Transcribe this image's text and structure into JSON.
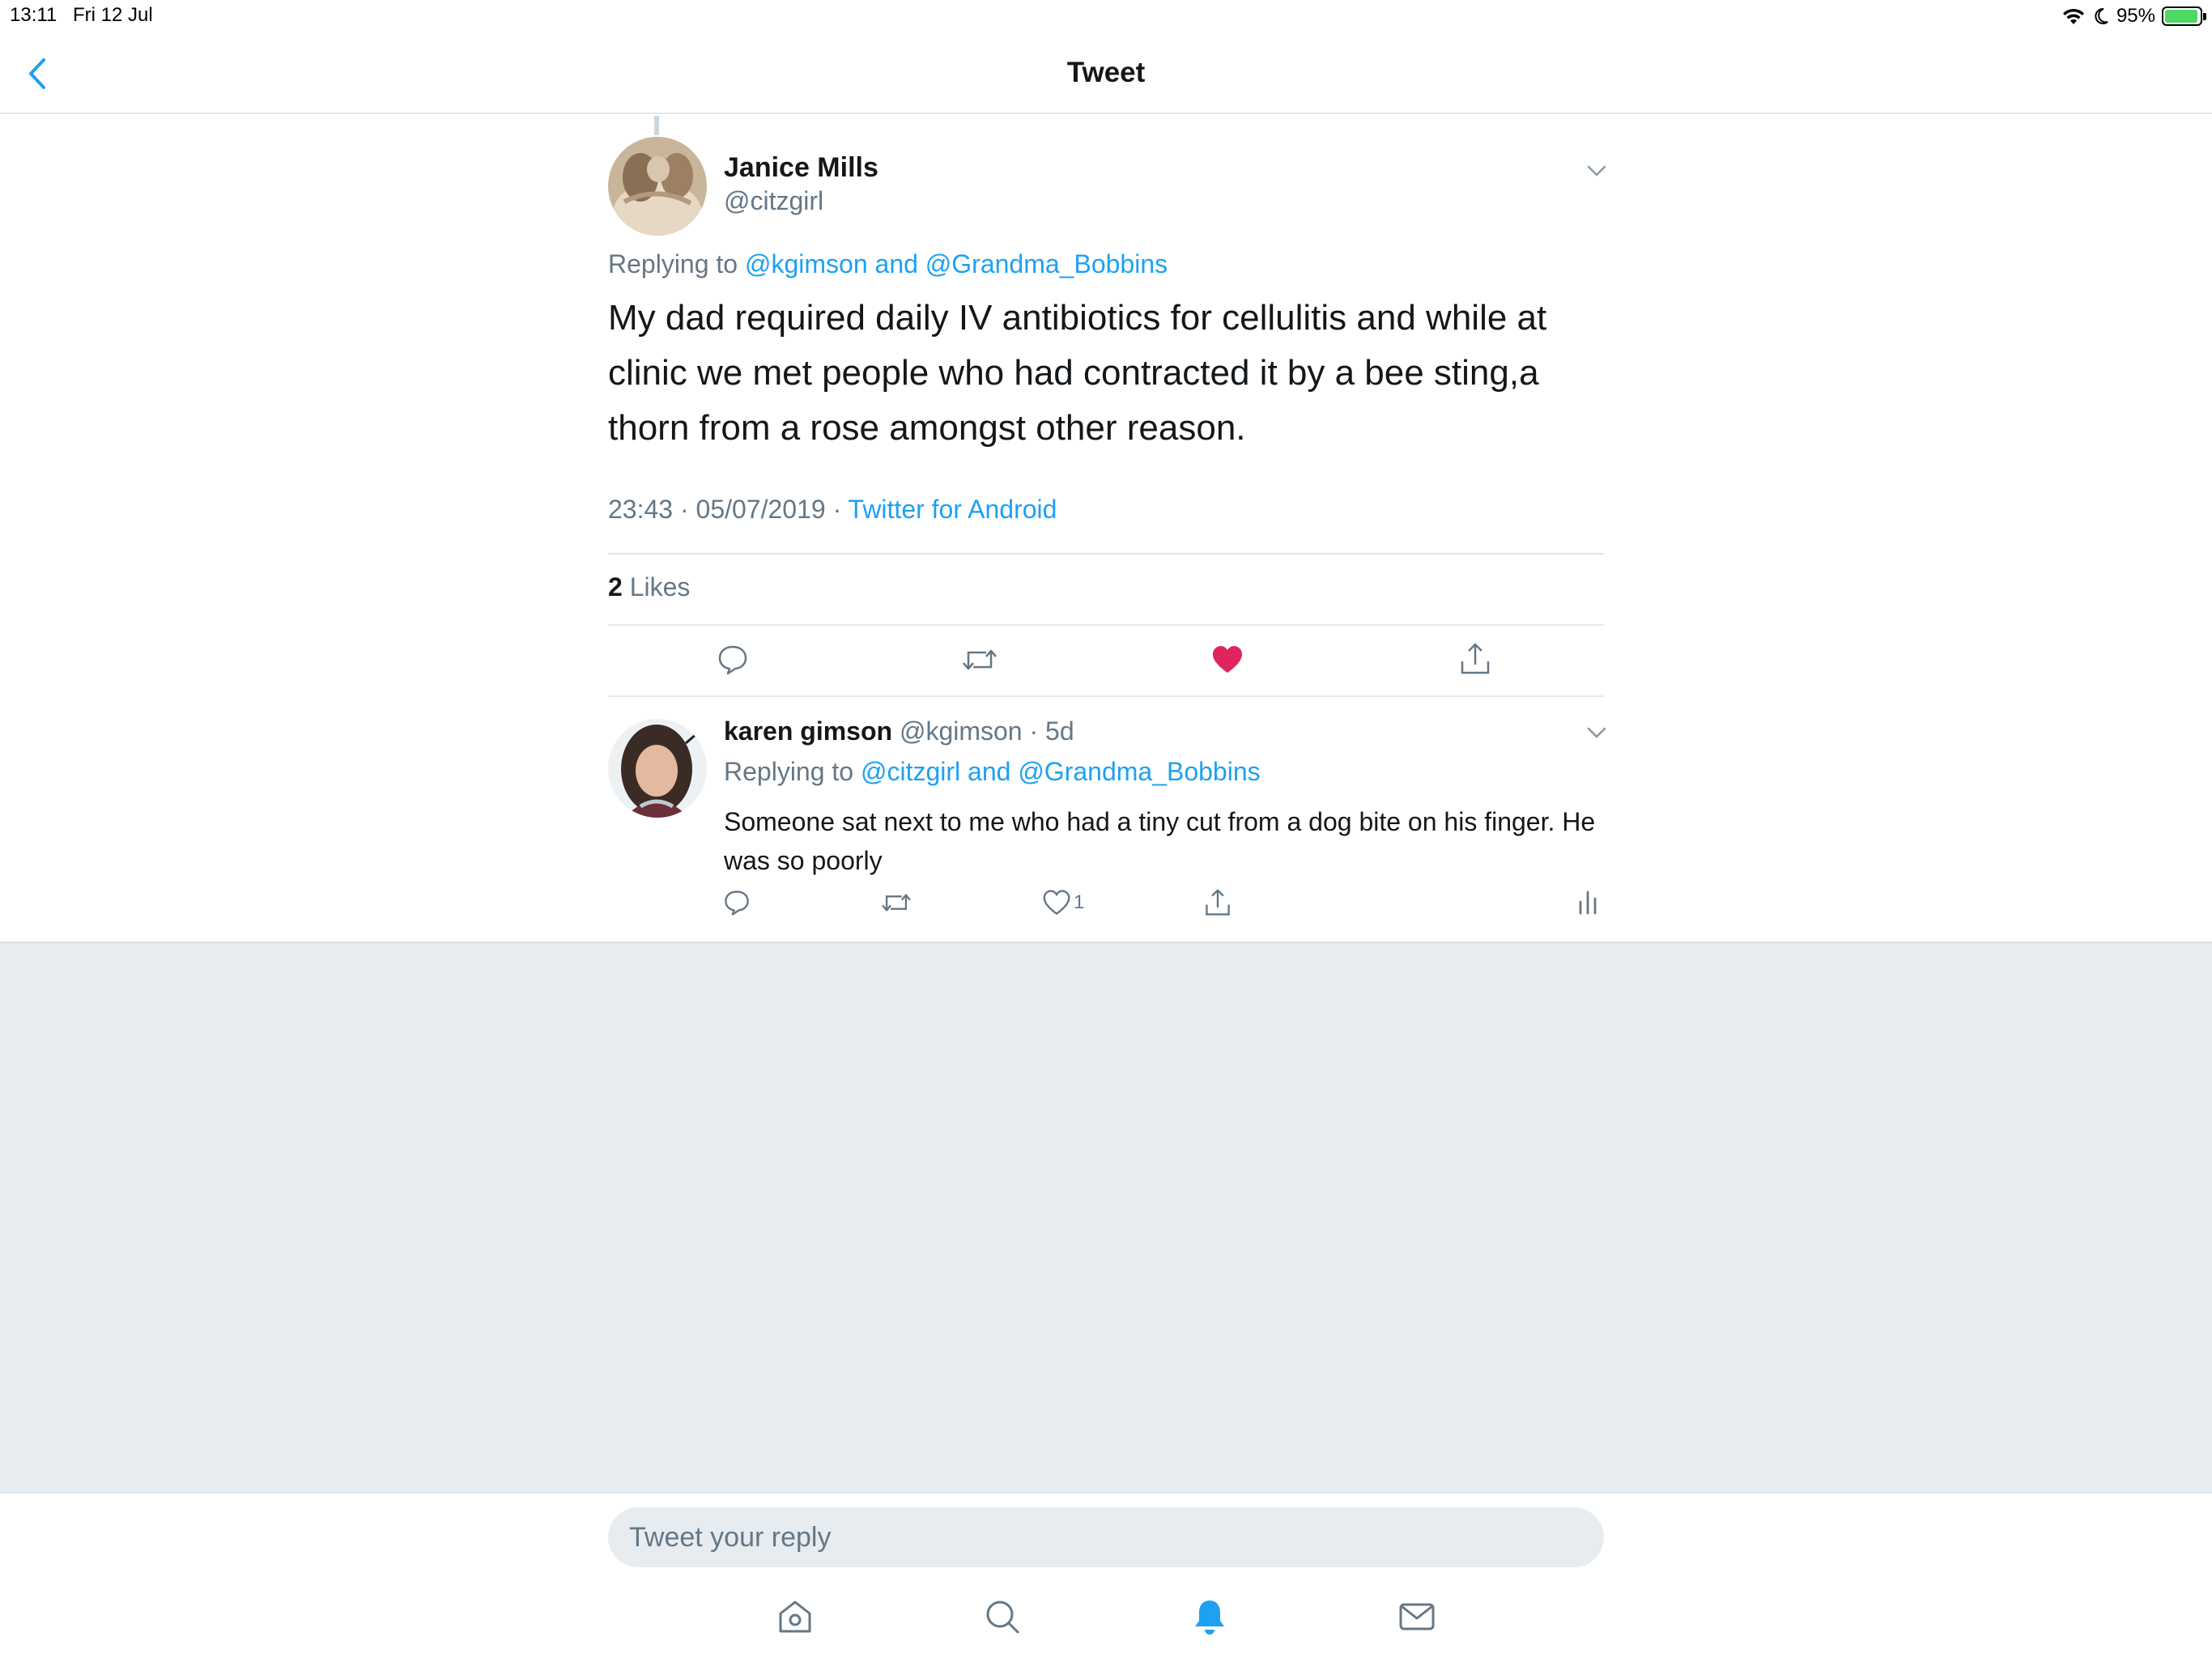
{
  "status_bar": {
    "time": "13:11",
    "date": "Fri 12 Jul",
    "battery": "95%",
    "battery_level": 0.95,
    "icons": [
      "wifi-icon",
      "moon-icon",
      "battery-icon"
    ]
  },
  "header": {
    "title": "Tweet",
    "back_icon": "chevron-left-icon"
  },
  "main_tweet": {
    "name": "Janice Mills",
    "handle": "@citzgirl",
    "replying_prefix": "Replying to",
    "replying_mentions": "@kgimson and @Grandma_Bobbins",
    "text": "My dad required daily  IV antibiotics for cellulitis and while at clinic we met people who had contracted it by a bee sting,a thorn from a rose amongst other reason.",
    "timestamp": "23:43 · 05/07/2019 · ",
    "source": "Twitter for Android",
    "likes_count": "2",
    "likes_label": " Likes",
    "liked": true
  },
  "reply_tweet": {
    "name": "karen gimson",
    "handle": "@kgimson",
    "age": "5d",
    "replying_prefix": "Replying to",
    "replying_mentions": "@citzgirl and @Grandma_Bobbins",
    "text": "Someone sat next to me who had a tiny cut from a  dog bite on his finger. He was so poorly",
    "like_count": "1"
  },
  "composer": {
    "placeholder": "Tweet your reply"
  },
  "tab_bar": {
    "tabs": [
      "home-icon",
      "search-icon",
      "notifications-icon",
      "messages-icon"
    ],
    "active": "notifications-icon"
  },
  "colors": {
    "accent": "#1da1f2",
    "like": "#e0245e",
    "secondary_text": "#657786",
    "primary_text": "#14171a",
    "background_gray": "#e6ecf0"
  }
}
